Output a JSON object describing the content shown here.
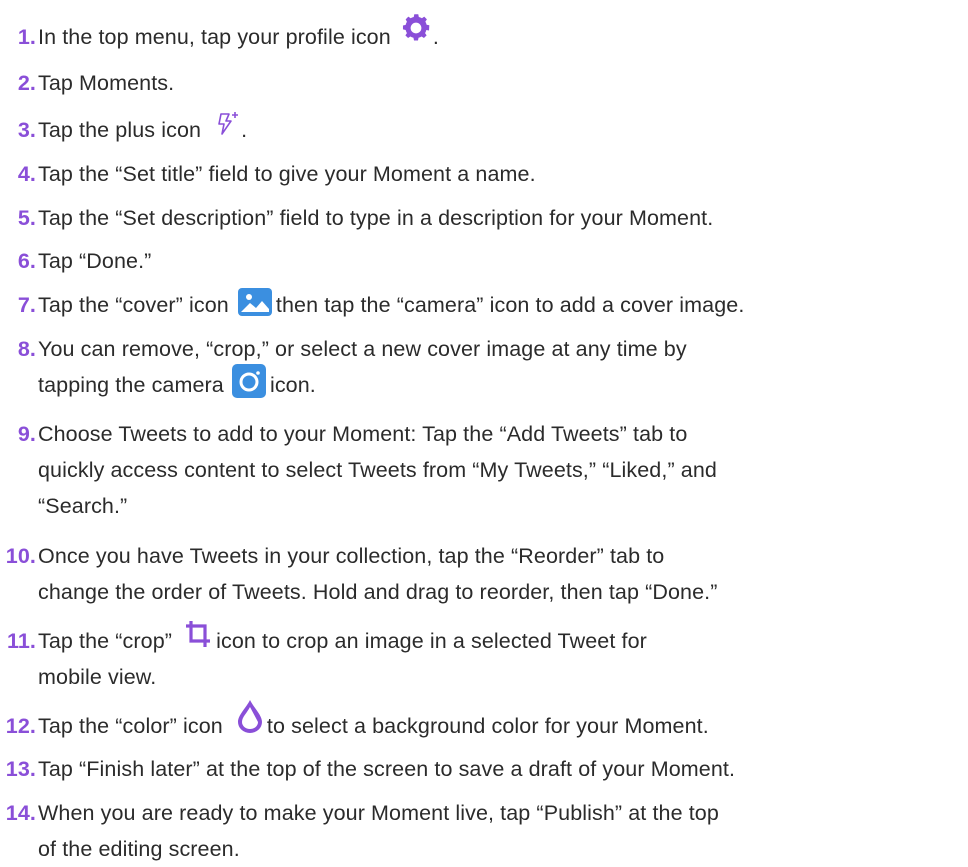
{
  "steps": [
    {
      "num": "1.",
      "text_before": "In the top menu, tap your profile icon ",
      "icon": "gear-icon",
      "text_after": "."
    },
    {
      "num": "2.",
      "text_before": "Tap Moments.",
      "icon": "",
      "text_after": ""
    },
    {
      "num": "3.",
      "text_before": "Tap the plus icon ",
      "icon": "lightning-plus-icon",
      "text_after": "."
    },
    {
      "num": "4.",
      "text_before": "Tap the “Set title” field to give your Moment a name.",
      "icon": "",
      "text_after": ""
    },
    {
      "num": "5.",
      "text_before": "Tap the “Set description” field to type in a description for your Moment.",
      "icon": "",
      "text_after": ""
    },
    {
      "num": "6.",
      "text_before": "Tap “Done.”",
      "icon": "",
      "text_after": ""
    },
    {
      "num": "7.",
      "text_before": "Tap the “cover” icon ",
      "icon": "image-cover-icon",
      "text_after": "then tap the “camera” icon  to add a cover image."
    },
    {
      "num": "8.",
      "line1": "You can remove, “crop,” or select a new cover image at any time by",
      "text_before": "tapping the camera ",
      "icon": "camera-icon",
      "text_after": "icon."
    },
    {
      "num": "9.",
      "line1": "Choose Tweets to add to your Moment: Tap the “Add Tweets” tab to",
      "line2": "quickly access content to select Tweets from “My Tweets,” “Liked,” and",
      "line3": "“Search.”"
    },
    {
      "num": "10.",
      "line1": "Once you have Tweets in your collection, tap the “Reorder” tab to",
      "line2": "change the order of Tweets. Hold and drag to reorder, then tap “Done.”"
    },
    {
      "num": "11.",
      "text_before": "Tap the “crop” ",
      "icon": "crop-icon",
      "text_after": "icon to crop an image in a selected Tweet for",
      "line2": "mobile view."
    },
    {
      "num": "12.",
      "text_before": "Tap the “color” icon ",
      "icon": "droplet-icon",
      "text_after": "to select a background color for your Moment."
    },
    {
      "num": "13.",
      "text_before": "Tap “Finish later” at the top of the screen to save a draft of your Moment.",
      "icon": "",
      "text_after": ""
    },
    {
      "num": "14.",
      "line1": "When you are ready to make your Moment live, tap “Publish” at the top",
      "line2": "of the editing screen."
    }
  ],
  "colors": {
    "number": "#8a4fd8",
    "text": "#2b2b2b",
    "icon_purple": "#8a4fd8",
    "icon_blue": "#3b8fe0"
  }
}
